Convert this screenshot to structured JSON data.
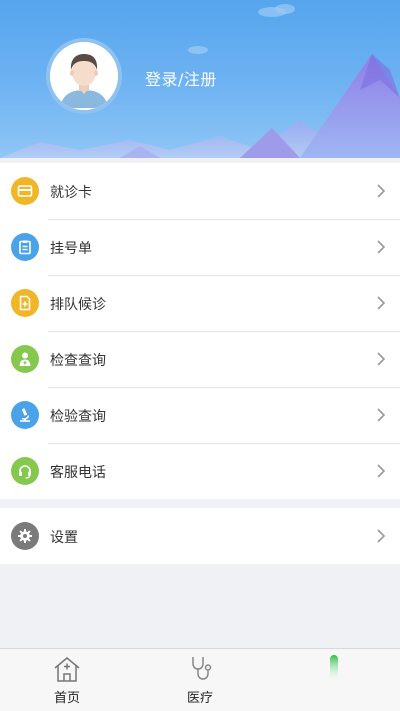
{
  "header": {
    "login_text": "登录/注册"
  },
  "menu": {
    "items": [
      {
        "label": "就诊卡",
        "icon": "card-icon",
        "color": "#f0b627"
      },
      {
        "label": "挂号单",
        "icon": "clipboard-icon",
        "color": "#4aa3e9"
      },
      {
        "label": "排队候诊",
        "icon": "queue-document-icon",
        "color": "#f0b627"
      },
      {
        "label": "检查查询",
        "icon": "doctor-icon",
        "color": "#86c84d"
      },
      {
        "label": "检验查询",
        "icon": "microscope-icon",
        "color": "#4aa3e9"
      },
      {
        "label": "客服电话",
        "icon": "headset-icon",
        "color": "#86c84d"
      }
    ]
  },
  "settings": {
    "label": "设置",
    "icon": "gear-icon",
    "color": "#7a7a7a"
  },
  "bottom_nav": {
    "items": [
      {
        "label": "首页",
        "icon": "home-medical-icon"
      },
      {
        "label": "医疗",
        "icon": "stethoscope-icon"
      }
    ]
  },
  "colors": {
    "header_top": "#55a5ee",
    "header_bottom": "#8fc6f6",
    "accent_green": "#2fbf4a"
  }
}
